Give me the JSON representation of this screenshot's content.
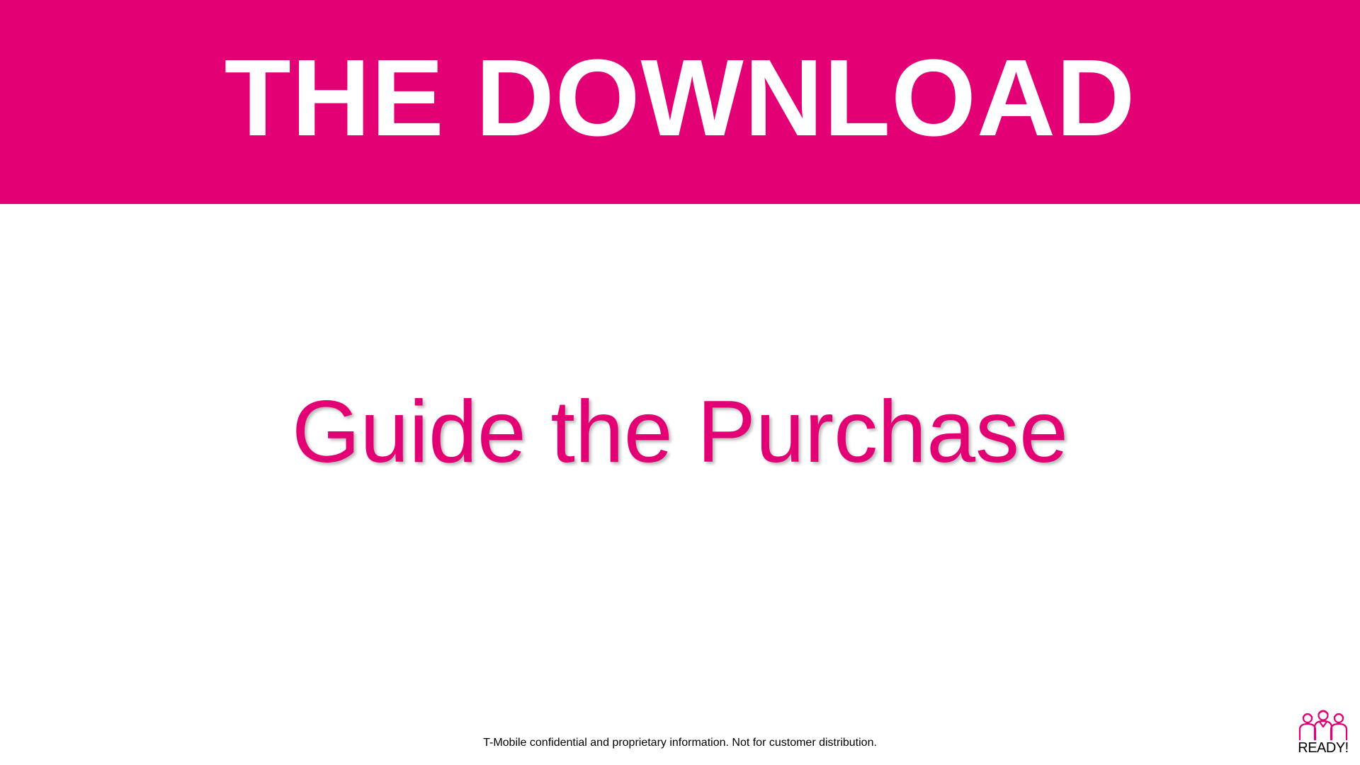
{
  "banner": {
    "title": "THE DOWNLOAD"
  },
  "main": {
    "subtitle": "Guide the Purchase"
  },
  "footer": {
    "confidential_note": "T-Mobile confidential and proprietary information. Not for customer distribution."
  },
  "logo": {
    "text": "READY!",
    "icon": "people-group-icon"
  },
  "colors": {
    "brand_magenta": "#e20074",
    "background": "#ffffff",
    "banner_text": "#ffffff",
    "footer_text": "#000000"
  }
}
